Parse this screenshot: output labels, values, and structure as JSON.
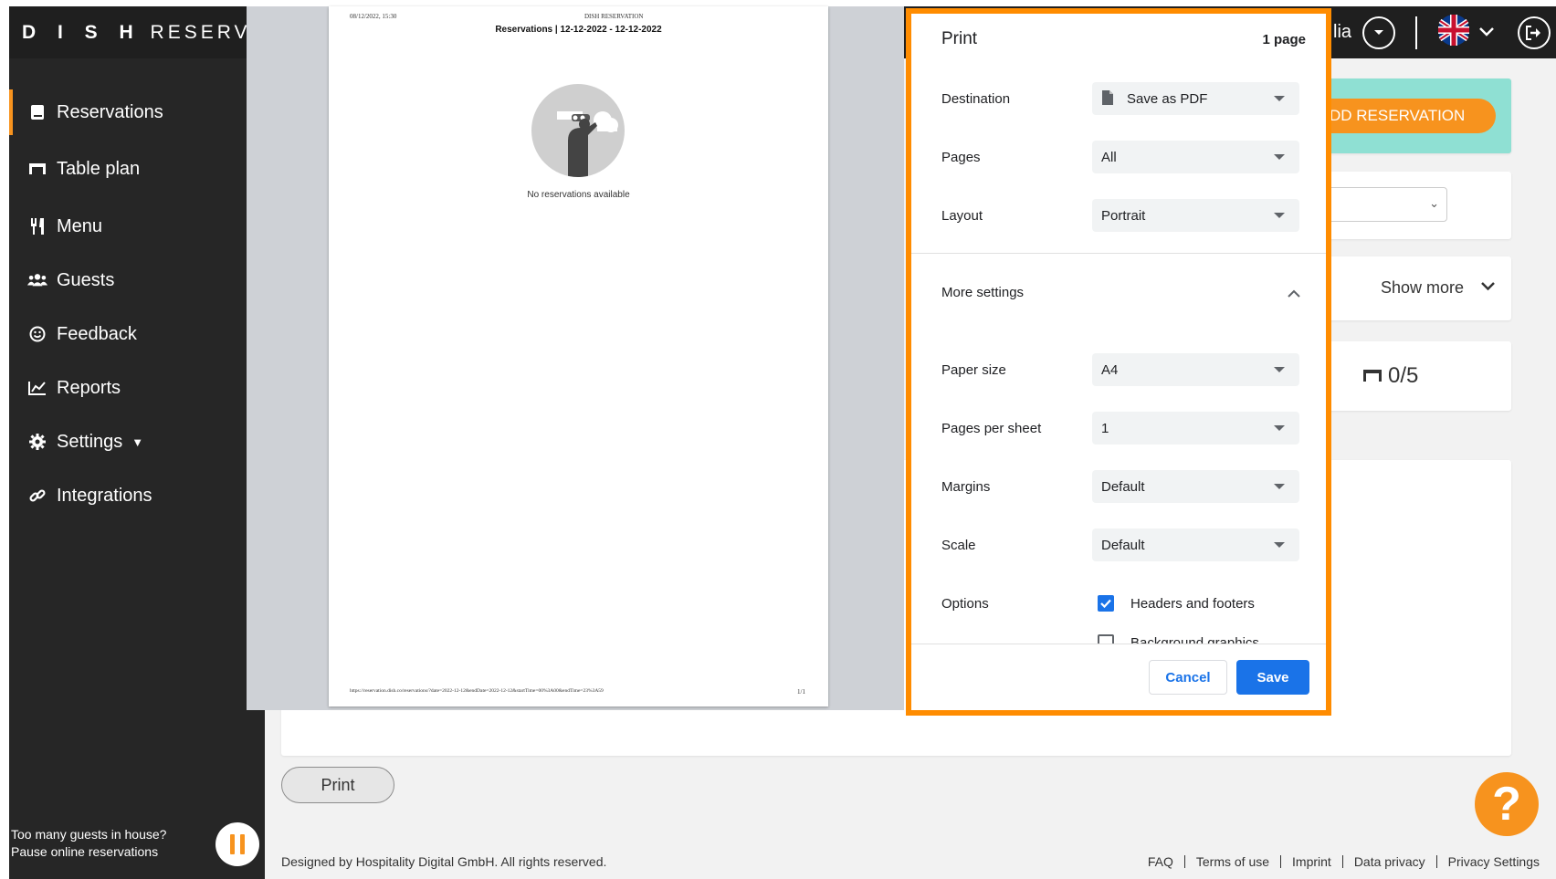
{
  "brand": {
    "bold": "D I S H",
    "rest": "RESERVATION"
  },
  "sidebar": {
    "items": [
      {
        "label": "Reservations",
        "icon": "book-icon"
      },
      {
        "label": "Table plan",
        "icon": "table-icon"
      },
      {
        "label": "Menu",
        "icon": "cutlery-icon"
      },
      {
        "label": "Guests",
        "icon": "users-icon"
      },
      {
        "label": "Feedback",
        "icon": "smile-icon"
      },
      {
        "label": "Reports",
        "icon": "chart-icon"
      },
      {
        "label": "Settings",
        "icon": "gear-icon"
      },
      {
        "label": "Integrations",
        "icon": "link-icon"
      }
    ],
    "pause_text_1": "Too many guests in house?",
    "pause_text_2": "Pause online reservations"
  },
  "topbar": {
    "user_partial": "lia"
  },
  "main": {
    "add_reservation": "DD RESERVATION",
    "show_more": "Show more",
    "table_count": "0/5",
    "print_button": "Print"
  },
  "footer": {
    "copyright": "Designed by Hospitality Digital GmbH. All rights reserved.",
    "links": [
      "FAQ",
      "Terms of use",
      "Imprint",
      "Data privacy",
      "Privacy Settings"
    ]
  },
  "preview": {
    "date": "08/12/2022, 15:30",
    "header": "DISH RESERVATION",
    "title": "Reservations | 12-12-2022 - 12-12-2022",
    "empty": "No reservations available",
    "url": "https://reservation.dish.co/reservations/?date=2022-12-12&endDate=2022-12-12&startTime=00%3A00&endTime=23%3A59",
    "page_num": "1/1"
  },
  "print_dialog": {
    "title": "Print",
    "page_count": "1 page",
    "destination_label": "Destination",
    "destination_value": "Save as PDF",
    "pages_label": "Pages",
    "pages_value": "All",
    "layout_label": "Layout",
    "layout_value": "Portrait",
    "more_settings": "More settings",
    "paper_size_label": "Paper size",
    "paper_size_value": "A4",
    "pages_per_sheet_label": "Pages per sheet",
    "pages_per_sheet_value": "1",
    "margins_label": "Margins",
    "margins_value": "Default",
    "scale_label": "Scale",
    "scale_value": "Default",
    "options_label": "Options",
    "headers_footers": "Headers and footers",
    "headers_footers_checked": true,
    "background_graphics": "Background graphics",
    "background_graphics_checked": false,
    "cancel": "Cancel",
    "save": "Save"
  },
  "colors": {
    "accent": "#f7931e",
    "highlight": "#ff8c00",
    "sidebar": "#262626",
    "primary": "#1a73e8",
    "teal": "#8fe0d3"
  }
}
